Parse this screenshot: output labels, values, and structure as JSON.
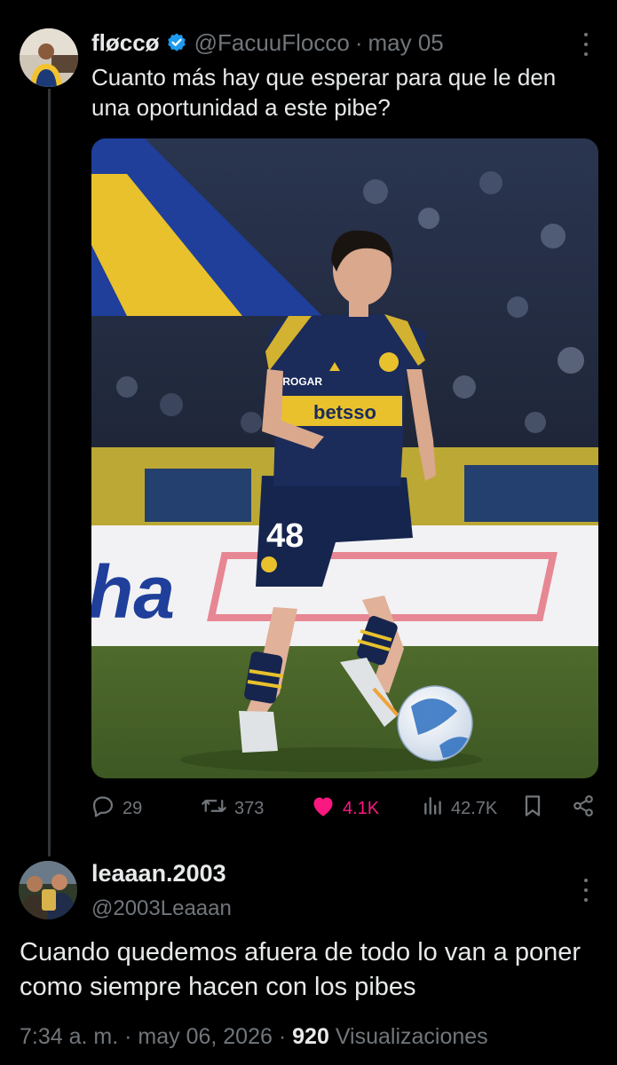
{
  "tweet1": {
    "author_name": "fløccø",
    "verified": true,
    "handle": "@FacuuFlocco",
    "separator": "·",
    "date": "may 05",
    "text": "Cuanto más hay que esperar para que le den una oportunidad a este pibe?",
    "photo": {
      "banner_text": "ha",
      "jersey_sponsor": "betsso",
      "jersey_number": "48",
      "sleeve_sponsor": "STROGAR"
    },
    "actions": {
      "replies": "29",
      "reposts": "373",
      "likes": "4.1K",
      "views": "42.7K"
    },
    "colors": {
      "like_active": "#f91880",
      "verified_badge": "#1d9bf0",
      "muted_text": "#71767b",
      "text": "#e7e9ea"
    }
  },
  "tweet2": {
    "author_name": "leaaan.2003",
    "handle": "@2003Leaaan",
    "text": "Cuando quedemos afuera de todo lo van a poner como siempre hacen con los pibes",
    "time": "7:34 a. m.",
    "separator": "·",
    "date": "may 06, 2026",
    "views_count": "920",
    "views_label": "Visualizaciones"
  }
}
